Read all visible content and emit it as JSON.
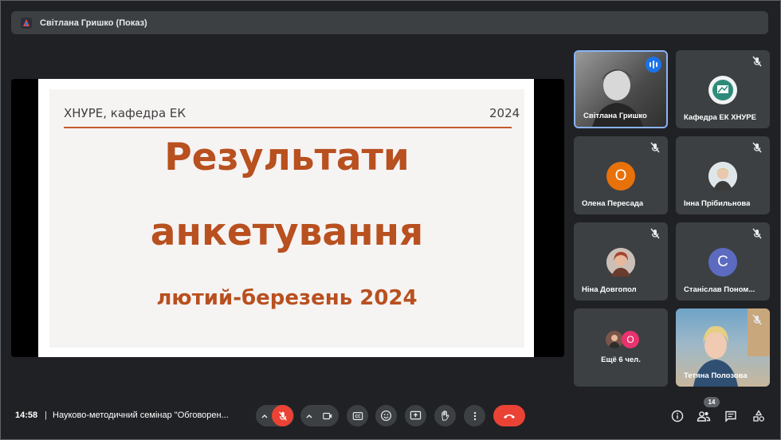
{
  "presenter": {
    "name": "Світлана Гришко (Показ)"
  },
  "slide": {
    "org": "ХНУРЕ, кафедра ЕК",
    "year": "2024",
    "title_line1": "Результати",
    "title_line2": "анкетування",
    "subtitle": "лютий-березень 2024"
  },
  "tiles": [
    {
      "name": "Світлана Гришко",
      "speaking": true
    },
    {
      "name": "Кафедра ЕК ХНУРЕ",
      "muted": true
    },
    {
      "name": "Олена Пересада",
      "initial": "О",
      "color": "#e8710a",
      "muted": true
    },
    {
      "name": "Інна Прібильнова",
      "muted": true
    },
    {
      "name": "Ніна Довгопол",
      "muted": true
    },
    {
      "name": "Станіслав Поном...",
      "initial": "С",
      "color": "#5c6bc0",
      "muted": true
    },
    {
      "name": "Ещё 6 чел.",
      "initial": "О",
      "color": "#e8336f"
    },
    {
      "name": "Тетяна Полозова",
      "muted": true
    }
  ],
  "bottom": {
    "time": "14:58",
    "separator": "|",
    "meeting_title": "Науково-методичний семінар \"Обговорен...",
    "participants_count": "14"
  },
  "colors": {
    "accent_red": "#ea4335",
    "slide_accent": "#b8501f",
    "surface": "#3c4043"
  }
}
